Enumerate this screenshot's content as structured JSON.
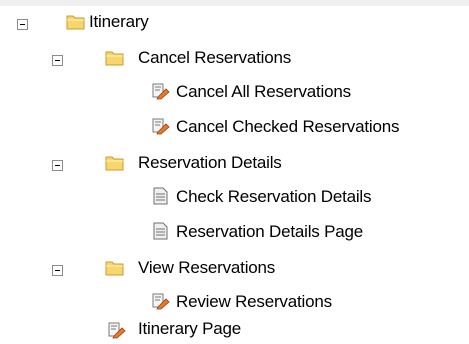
{
  "tree": {
    "root": {
      "label": "Itinerary",
      "icon": "folder-icon",
      "expanded": true
    },
    "cancel_reservations": {
      "label": "Cancel Reservations",
      "icon": "folder-icon",
      "expanded": true,
      "children": [
        {
          "label": "Cancel All Reservations",
          "icon": "action-pencil-icon"
        },
        {
          "label": "Cancel Checked Reservations",
          "icon": "action-pencil-icon"
        }
      ]
    },
    "reservation_details": {
      "label": "Reservation Details",
      "icon": "folder-icon",
      "expanded": true,
      "children": [
        {
          "label": "Check Reservation Details",
          "icon": "page-icon"
        },
        {
          "label": "Reservation Details Page",
          "icon": "page-icon"
        }
      ]
    },
    "view_reservations": {
      "label": "View Reservations",
      "icon": "folder-icon",
      "expanded": true,
      "children": [
        {
          "label": "Review Reservations",
          "icon": "action-pencil-icon"
        }
      ]
    },
    "itinerary_page": {
      "label": "Itinerary Page",
      "icon": "action-pencil-icon"
    }
  },
  "colors": {
    "folder_fill": "#f7d66b",
    "folder_edge": "#c89b2f",
    "pencil_body": "#e57a2b",
    "page_gray": "#6f6f6f"
  }
}
